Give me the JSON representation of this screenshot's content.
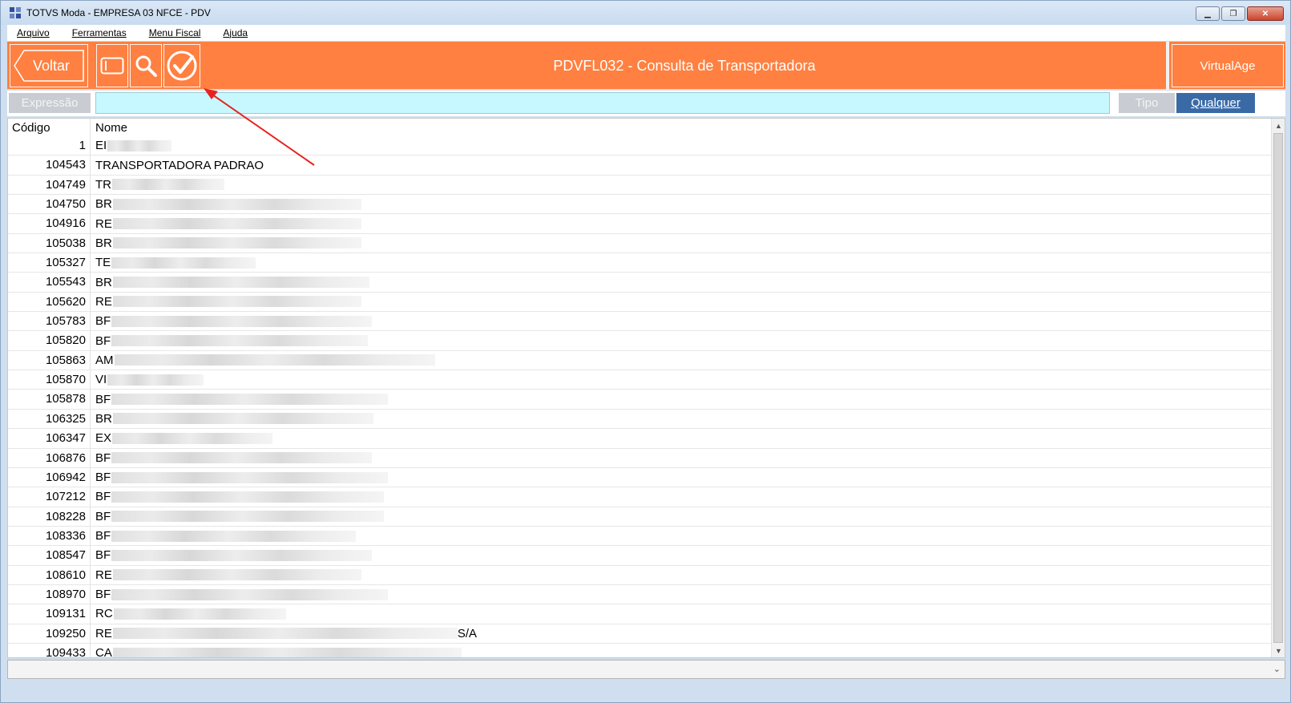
{
  "window": {
    "title": "TOTVS Moda - EMPRESA 03 NFCE - PDV"
  },
  "menu": [
    {
      "label": "Arquivo"
    },
    {
      "label": "Ferramentas"
    },
    {
      "label": "Menu Fiscal"
    },
    {
      "label": "Ajuda"
    }
  ],
  "toolbar": {
    "back_label": "Voltar",
    "card_icon": "card-icon",
    "search_icon": "search-icon",
    "confirm_icon": "checkmark-icon",
    "title": "PDVFL032 - Consulta de Transportadora",
    "brand": "VirtualAge",
    "accent_color": "#ff8040"
  },
  "search": {
    "expression_label": "Expressão",
    "value": "",
    "type_label": "Tipo",
    "type_value": "Qualquer"
  },
  "grid": {
    "headers": {
      "code": "Código",
      "name": "Nome"
    },
    "rows": [
      {
        "code": "1",
        "name": "EI"
      },
      {
        "code": "104543",
        "name": "TRANSPORTADORA PADRAO"
      },
      {
        "code": "104749",
        "name": "TR"
      },
      {
        "code": "104750",
        "name": "BR"
      },
      {
        "code": "104916",
        "name": "RE"
      },
      {
        "code": "105038",
        "name": "BR"
      },
      {
        "code": "105327",
        "name": "TE"
      },
      {
        "code": "105543",
        "name": "BR"
      },
      {
        "code": "105620",
        "name": "RE"
      },
      {
        "code": "105783",
        "name": "BF"
      },
      {
        "code": "105820",
        "name": "BF"
      },
      {
        "code": "105863",
        "name": "AM"
      },
      {
        "code": "105870",
        "name": "VI"
      },
      {
        "code": "105878",
        "name": "BF"
      },
      {
        "code": "106325",
        "name": "BR"
      },
      {
        "code": "106347",
        "name": "EX"
      },
      {
        "code": "106876",
        "name": "BF"
      },
      {
        "code": "106942",
        "name": "BF"
      },
      {
        "code": "107212",
        "name": "BF"
      },
      {
        "code": "108228",
        "name": "BF"
      },
      {
        "code": "108336",
        "name": "BF"
      },
      {
        "code": "108547",
        "name": "BF"
      },
      {
        "code": "108610",
        "name": "RE"
      },
      {
        "code": "108970",
        "name": "BF"
      },
      {
        "code": "109131",
        "name": "RC"
      },
      {
        "code": "109250",
        "name": "RE",
        "suffix": "S/A"
      },
      {
        "code": "109433",
        "name": "CA"
      }
    ]
  }
}
